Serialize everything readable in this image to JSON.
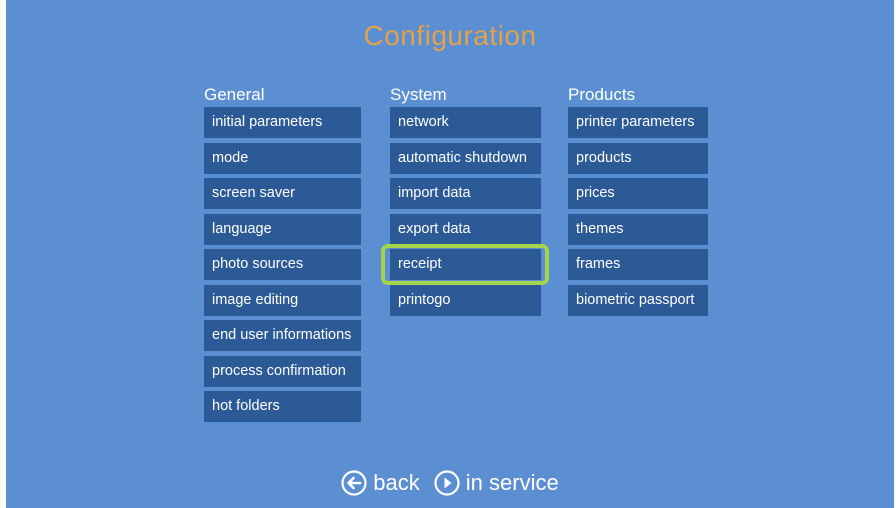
{
  "title": "Configuration",
  "columns": {
    "general": {
      "heading": "General",
      "items": [
        "initial parameters",
        "mode",
        "screen saver",
        "language",
        "photo sources",
        "image editing",
        "end user informations",
        "process confirmation",
        "hot folders"
      ]
    },
    "system": {
      "heading": "System",
      "items": [
        "network",
        "automatic shutdown",
        "import data",
        "export data",
        "receipt",
        "printogo"
      ],
      "highlighted_item": "receipt"
    },
    "products": {
      "heading": "Products",
      "items": [
        "printer parameters",
        "products",
        "prices",
        "themes",
        "frames",
        "biometric passport"
      ]
    }
  },
  "footer": {
    "back_label": "back",
    "back_icon": "arrow-left-circle-icon",
    "in_service_label": "in service",
    "in_service_icon": "play-circle-icon"
  },
  "colors": {
    "background": "#5b8fd1",
    "button": "#2c5a96",
    "title": "#e2a24a",
    "highlight": "#a4d44a"
  }
}
